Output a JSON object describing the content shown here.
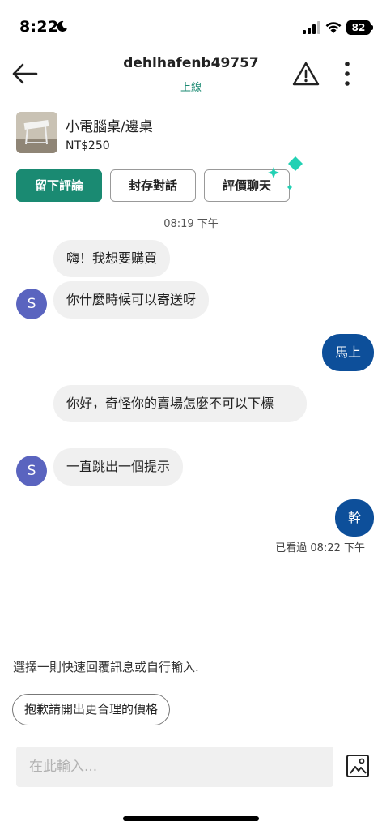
{
  "status_bar": {
    "time": "8:22",
    "battery": "82"
  },
  "header": {
    "username": "dehlhafenb49757",
    "online_status": "上線"
  },
  "product": {
    "name": "小電腦桌/邊桌",
    "price": "NT$250"
  },
  "actions": {
    "review": "留下評論",
    "archive": "封存對話",
    "rate": "評價聊天"
  },
  "chat": {
    "timestamp": "08:19 下午",
    "avatar_initial": "S",
    "messages": [
      {
        "side": "in",
        "text": "嗨！我想要購買"
      },
      {
        "side": "in",
        "text": "你什麼時候可以寄送呀"
      },
      {
        "side": "out",
        "text": "馬上"
      },
      {
        "side": "in",
        "text": "你好，奇怪你的賣場怎麼不可以下標"
      },
      {
        "side": "in",
        "text": "一直跳出一個提示"
      },
      {
        "side": "out",
        "text": "幹"
      }
    ],
    "read_receipt": "已看過 08:22 下午"
  },
  "quick_replies": {
    "prompt": "選擇一則快速回覆訊息或自行輸入.",
    "options": [
      "抱歉請開出更合理的價格"
    ]
  },
  "composer": {
    "placeholder": "在此輸入..."
  },
  "colors": {
    "brand_green": "#1a8a72",
    "outgoing_bubble": "#0d4f9a",
    "avatar": "#5a64bf",
    "incoming_bubble": "#f0f0f0"
  }
}
